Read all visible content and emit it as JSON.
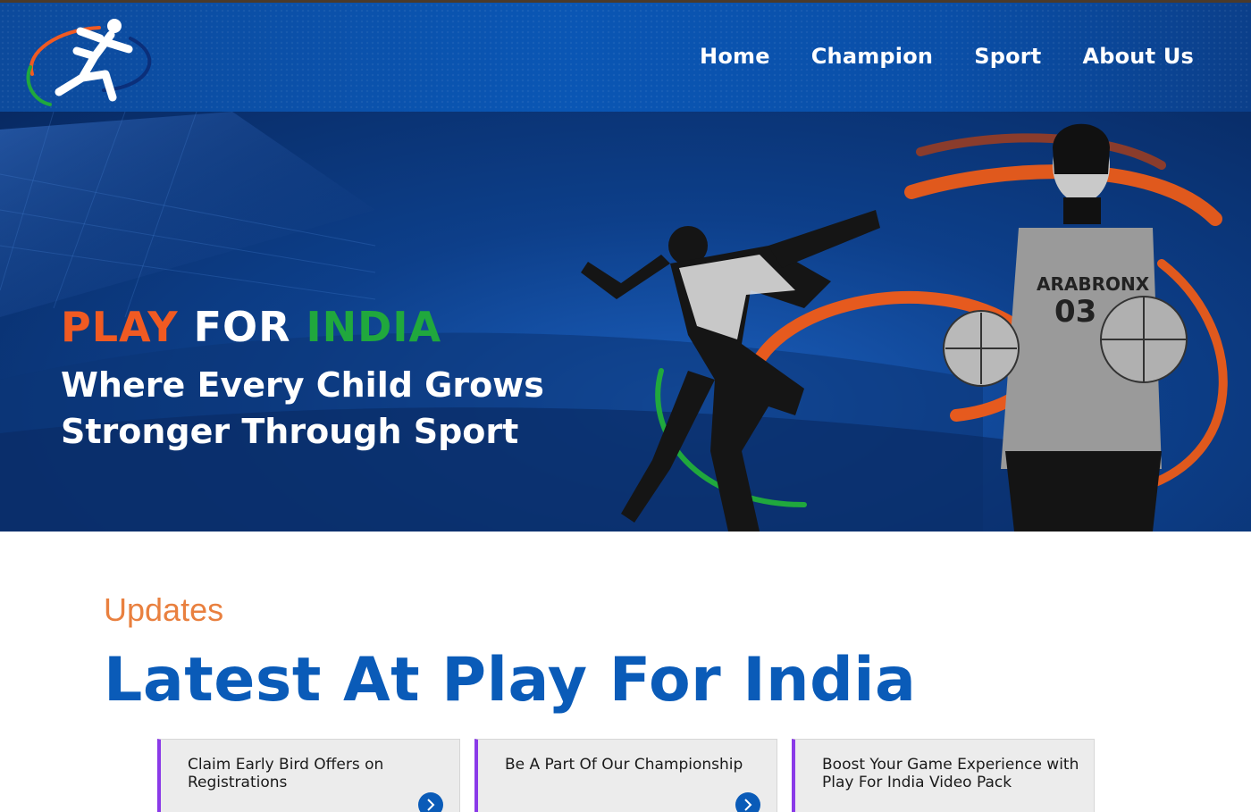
{
  "header": {
    "logo_name": "running-athlete-logo",
    "nav": [
      {
        "label": "Home"
      },
      {
        "label": "Champion"
      },
      {
        "label": "Sport"
      },
      {
        "label": "About Us"
      }
    ]
  },
  "hero": {
    "brand": {
      "play": "PLAY",
      "for": "FOR",
      "india": "INDIA"
    },
    "tagline": "Where Every Child Grows Stronger Through Sport",
    "jersey_text": "ARABRONX 03"
  },
  "updates": {
    "eyebrow": "Updates",
    "title": "Latest At Play For India",
    "cards": [
      {
        "text": "Claim Early Bird Offers on Registrations"
      },
      {
        "text": "Be A Part Of Our Championship"
      },
      {
        "text": "Boost Your Game Experience with Play For India Video Pack"
      }
    ]
  },
  "colors": {
    "header_blue": "#0a56b4",
    "brand_orange": "#f05a22",
    "brand_green": "#20a83d",
    "title_blue": "#0a5bb8",
    "eyebrow_orange": "#e9803f",
    "card_accent": "#8a3ae8"
  }
}
